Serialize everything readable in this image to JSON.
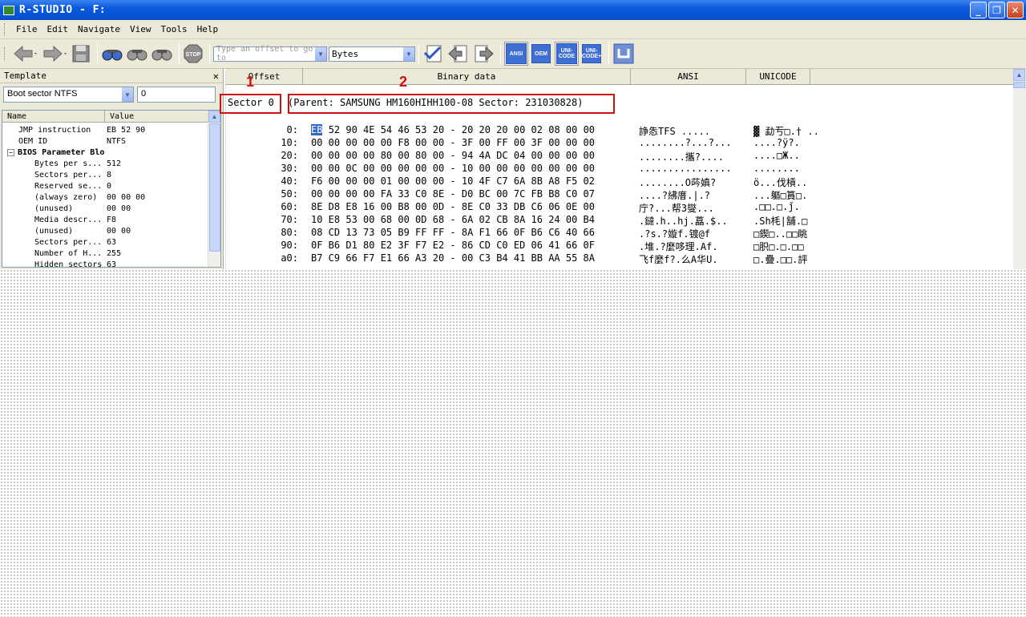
{
  "window": {
    "title": "R-STUDIO - F:"
  },
  "menu": [
    "File",
    "Edit",
    "Navigate",
    "View",
    "Tools",
    "Help"
  ],
  "toolbar": {
    "offset_placeholder": "Type an offset to go to",
    "view_mode": "Bytes",
    "stop_label": "STOP",
    "enc": {
      "ansi": "ANSI",
      "oem": "OEM",
      "unicode": "UNI-CODE",
      "unicode2": "UNI-CODE+"
    }
  },
  "template_panel": {
    "title": "Template",
    "close": "✕",
    "template": "Boot sector NTFS",
    "index": "0",
    "columns": [
      "Name",
      "Value"
    ],
    "rows": [
      {
        "name": "JMP instruction",
        "value": "EB 52 90",
        "level": 0
      },
      {
        "name": "OEM ID",
        "value": "NTFS",
        "level": 0
      },
      {
        "name": "BIOS Parameter Block",
        "value": "",
        "level": 0,
        "bold": true,
        "expander": "−"
      },
      {
        "name": "Bytes per s...",
        "value": "512",
        "level": 1
      },
      {
        "name": "Sectors per...",
        "value": "8",
        "level": 1
      },
      {
        "name": "Reserved se...",
        "value": "0",
        "level": 1
      },
      {
        "name": "(always zero)",
        "value": "00 00 00",
        "level": 1
      },
      {
        "name": "(unused)",
        "value": "00 00",
        "level": 1
      },
      {
        "name": "Media descr...",
        "value": "F8",
        "level": 1
      },
      {
        "name": "(unused)",
        "value": "00 00",
        "level": 1
      },
      {
        "name": "Sectors per...",
        "value": "63",
        "level": 1
      },
      {
        "name": "Number of H...",
        "value": "255",
        "level": 1
      },
      {
        "name": "Hidden sectors",
        "value": "63",
        "level": 1
      }
    ]
  },
  "hex": {
    "columns": {
      "offset": "Offset",
      "binary": "Binary data",
      "ansi": "ANSI",
      "unicode": "UNICODE"
    },
    "sector_label": "Sector 0",
    "parent_label": "(Parent: SAMSUNG HM160HIHH100-08 Sector: 231030828)",
    "annot1": "1",
    "annot2": "2",
    "first_byte": "EB",
    "rows": [
      {
        "off": "0:",
        "bytes": "52 90 4E 54 46 53 20 - 20 20 20 00 02 08 00 00",
        "ansi": "諍怣TFS    .....",
        "uni": "▓ 勐亐□.† .."
      },
      {
        "off": "10:",
        "bytes": "00 00 00 00 00 F8 00 00 - 3F 00 FF 00 3F 00 00 00",
        "ansi": "........?...?...",
        "uni": "....?ÿ?."
      },
      {
        "off": "20:",
        "bytes": "00 00 00 00 80 00 80 00 - 94 4A DC 04 00 00 00 00",
        "ansi": "........攜?....",
        "uni": "....□Ж.."
      },
      {
        "off": "30:",
        "bytes": "00 00 0C 00 00 00 00 00 - 10 00 00 00 00 00 00 00",
        "ansi": "................",
        "uni": "........"
      },
      {
        "off": "40:",
        "bytes": "F6 00 00 00 01 00 00 00 - 10 4F C7 6A 8B A8 F5 02",
        "ansi": "........O荶嫃?",
        "uni": "ö...伐槓.."
      },
      {
        "off": "50:",
        "bytes": "00 00 00 00 FA 33 C0 8E - D0 BC 00 7C FB B8 C0 07",
        "ansi": "....?紼庴.|.?",
        "uni": "...軀□篔□."
      },
      {
        "off": "60:",
        "bytes": "8E D8 E8 16 00 B8 00 0D - 8E C0 33 DB C6 06 0E 00",
        "ansi": "庁?...帮3燮...",
        "uni": ".□□.□.ǰ."
      },
      {
        "off": "70:",
        "bytes": "10 E8 53 00 68 00 0D 68 - 6A 02 CB 8A 16 24 00 B4",
        "ansi": ".鐽.h..hj.藠.$..",
        "uni": ".Sh枆|舗.□"
      },
      {
        "off": "80:",
        "bytes": "08 CD 13 73 05 B9 FF FF - 8A F1 66 0F B6 C6 40 66",
        "ansi": ".?s.?嫙f.镀@f",
        "uni": "□鍥□..□□眺"
      },
      {
        "off": "90:",
        "bytes": "0F B6 D1 80 E2 3F F7 E2 - 86 CD C0 ED 06 41 66 0F",
        "ansi": ".堆.?麼哆理.Af.",
        "uni": "□胑□.□.□□"
      },
      {
        "off": "a0:",
        "bytes": "B7 C9 66 F7 E1 66 A3 20 - 00 C3 B4 41 BB AA 55 8A",
        "ansi": "飞f麼f?.么A华U.",
        "uni": "□.疊.□□.評"
      }
    ]
  }
}
